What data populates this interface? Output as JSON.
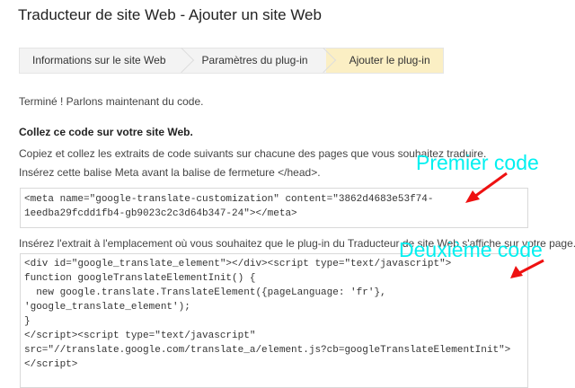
{
  "title": "Traducteur de site Web - Ajouter un site Web",
  "steps": [
    "Informations sur le site Web",
    "Paramètres du plug-in",
    "Ajouter le plug-in"
  ],
  "status": "Terminé ! Parlons maintenant du code.",
  "heading": "Collez ce code sur votre site Web.",
  "intro": "Copiez et collez les extraits de code suivants sur chacune des pages que vous souhaitez traduire.",
  "meta_label": "Insérez cette balise Meta avant la balise de fermeture </head>.",
  "meta_code": "<meta name=\"google-translate-customization\" content=\"3862d4683e53f74-\n1eedba29fcdd1fb4-gb9023c2c3d64b347-24\"></meta>",
  "snippet_label": "Insérez l'extrait à l'emplacement où vous souhaitez que le plug-in du Traducteur de site Web s'affiche sur votre page.",
  "snippet_code": "<div id=\"google_translate_element\"></div><script type=\"text/javascript\">\nfunction googleTranslateElementInit() {\n  new google.translate.TranslateElement({pageLanguage: 'fr'},\n'google_translate_element');\n}\n</script><script type=\"text/javascript\"\nsrc=\"//translate.google.com/translate_a/element.js?cb=googleTranslateElementInit\">\n</script>",
  "annotations": {
    "first": "Premier code",
    "second": "Deuxième code",
    "color": "#00f0f0",
    "arrow_color": "#ee1111"
  }
}
